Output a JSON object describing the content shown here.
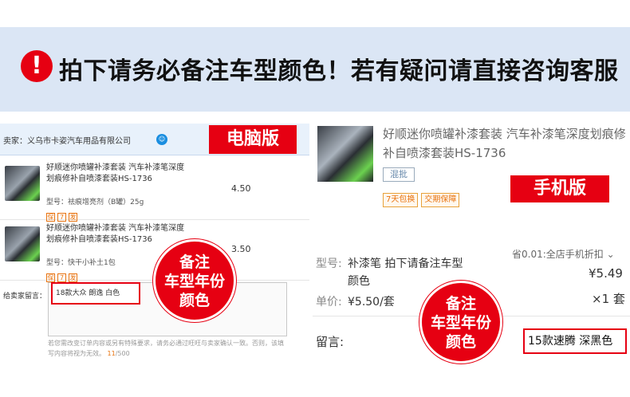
{
  "banner": {
    "icon": "!",
    "text": "拍下请务必备注车型颜色！若有疑问请直接咨询客服",
    "background": "#dbe6f5",
    "icon_color": "#e60012"
  },
  "pc": {
    "tag": "电脑版",
    "seller": "卖家：义乌市卡姿汽车用品有限公司",
    "items": [
      {
        "title": "好顺迷你喷罐补漆套装 汽车补漆笔深度划痕修补自喷漆套装HS-1736",
        "sku": "型号：祛痕增亮剂（B罐）25g",
        "price": "4.50"
      },
      {
        "title": "好顺迷你喷罐补漆套装 汽车补漆笔深度划痕修补自喷漆套装HS-1736",
        "sku": "型号：快干小补土1包",
        "price": "3.50"
      }
    ],
    "message_label": "给卖家留言：",
    "message_value": "18款大众 朗逸 白色",
    "hint": "若您需改变订单内容或另有特殊要求，请务必通过旺旺与卖家确认一致。否则，该填写内容将视为无效。",
    "count": "11",
    "count_max": "/500",
    "note": "备注\n车型年份\n颜色"
  },
  "mobile": {
    "tag": "手机版",
    "title": "好顺迷你喷罐补漆套装 汽车补漆笔深度划痕修补自喷漆套装HS-1736",
    "batch": "混批",
    "badges": [
      "7天包换",
      "交期保障"
    ],
    "sku_label": "型号:",
    "sku_value": "补漆笔 拍下请备注车型 颜色",
    "discount": "省0.01:全店手机折扣",
    "price": "¥5.49",
    "unit_label": "单价:",
    "unit_value": "¥5.50/套",
    "qty": "×1 套",
    "message_label": "留言:",
    "message_value": "15款速腾 深黑色",
    "note": "备注\n车型年份\n颜色"
  },
  "colors": {
    "accent": "#e60012",
    "orange": "#e8730f"
  }
}
